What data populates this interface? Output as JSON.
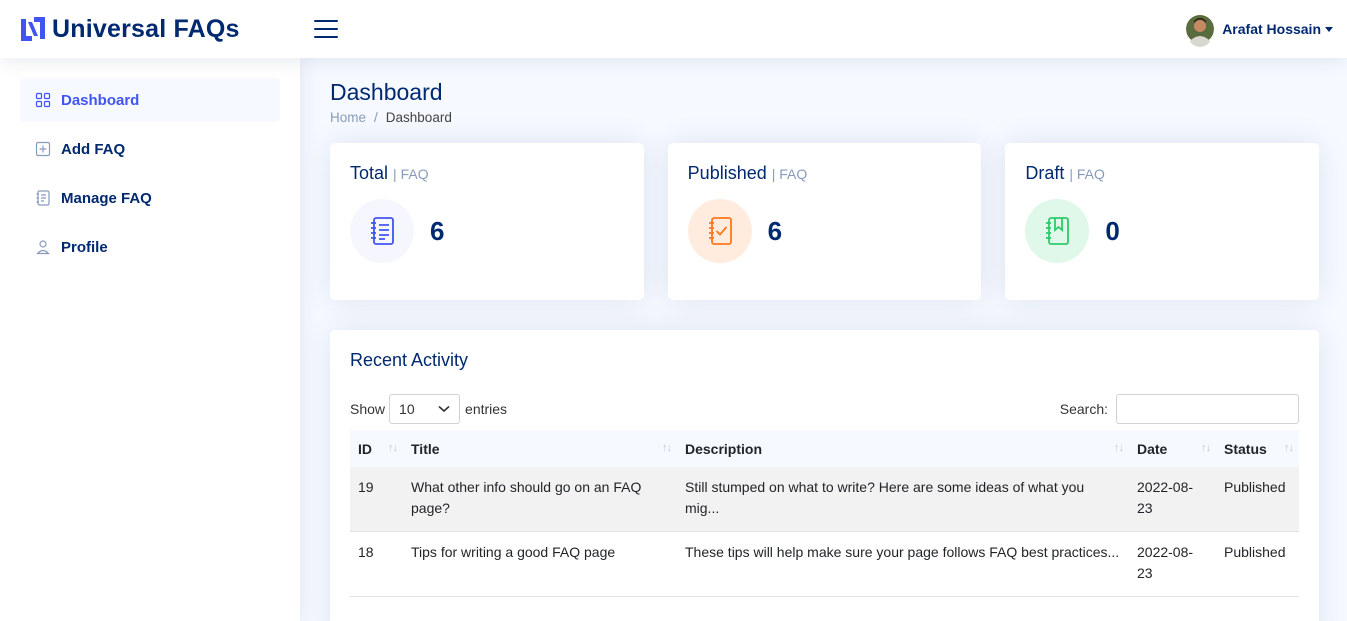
{
  "app": {
    "name": "Universal FAQs"
  },
  "user": {
    "name": "Arafat Hossain"
  },
  "sidebar": {
    "items": [
      {
        "label": "Dashboard",
        "icon": "grid-icon",
        "active": true
      },
      {
        "label": "Add FAQ",
        "icon": "plus-square-icon",
        "active": false
      },
      {
        "label": "Manage FAQ",
        "icon": "journal-text-icon",
        "active": false
      },
      {
        "label": "Profile",
        "icon": "person-icon",
        "active": false
      }
    ]
  },
  "page": {
    "title": "Dashboard",
    "breadcrumb": [
      "Home",
      "Dashboard"
    ]
  },
  "cards": [
    {
      "title": "Total",
      "sub": "| FAQ",
      "value": "6",
      "icon": "journal-text-icon",
      "color": "#4154f1",
      "bg": "#f6f6fe"
    },
    {
      "title": "Published",
      "sub": "| FAQ",
      "value": "6",
      "icon": "journal-check-icon",
      "color": "#ff771d",
      "bg": "#ffecdf"
    },
    {
      "title": "Draft",
      "sub": "| FAQ",
      "value": "0",
      "icon": "journal-bookmark-icon",
      "color": "#2eca6a",
      "bg": "#e0f8e9"
    }
  ],
  "activity": {
    "title": "Recent Activity",
    "show_label": "Show",
    "entries_value": "10",
    "entries_label": "entries",
    "search_label": "Search:",
    "search_value": "",
    "columns": [
      "ID",
      "Title",
      "Description",
      "Date",
      "Status"
    ],
    "rows": [
      {
        "id": "19",
        "title": "What other info should go on an FAQ page?",
        "description": "Still stumped on what to write? Here are some ideas of what you mig...",
        "date": "2022-08-23",
        "status": "Published"
      },
      {
        "id": "18",
        "title": "Tips for writing a good FAQ page",
        "description": "These tips will help make sure your page follows FAQ best practices...",
        "date": "2022-08-23",
        "status": "Published"
      }
    ]
  },
  "colors": {
    "primary": "#4154f1",
    "navy": "#012970",
    "muted": "#899bbd"
  }
}
